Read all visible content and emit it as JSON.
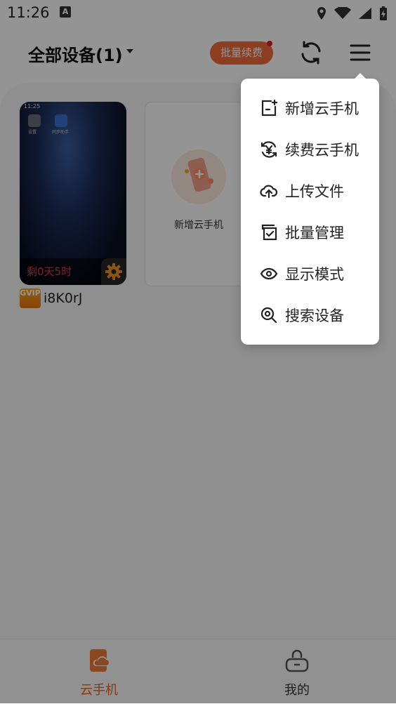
{
  "status": {
    "time": "11:26",
    "indicator": "A"
  },
  "header": {
    "title": "全部设备(1)",
    "batch_renew_label": "批量续费",
    "accent_color": "#f26b3a"
  },
  "devices": [
    {
      "remaining": "剩0天5时",
      "badge": "GVIP",
      "name": "i8K0rJ",
      "mini_time": "11:25",
      "mini_app1": "设置",
      "mini_app2": "同步助手"
    }
  ],
  "add_card": {
    "label": "新增云手机"
  },
  "menu": {
    "items": [
      {
        "label": "新增云手机",
        "icon": "add-phone-icon"
      },
      {
        "label": "续费云手机",
        "icon": "renew-yen-icon"
      },
      {
        "label": "上传文件",
        "icon": "cloud-upload-icon"
      },
      {
        "label": "批量管理",
        "icon": "batch-check-icon"
      },
      {
        "label": "显示模式",
        "icon": "eye-icon"
      },
      {
        "label": "搜索设备",
        "icon": "search-device-icon"
      }
    ]
  },
  "nav": {
    "cloud_phone": "云手机",
    "mine": "我的",
    "active_color": "#e8611c"
  }
}
